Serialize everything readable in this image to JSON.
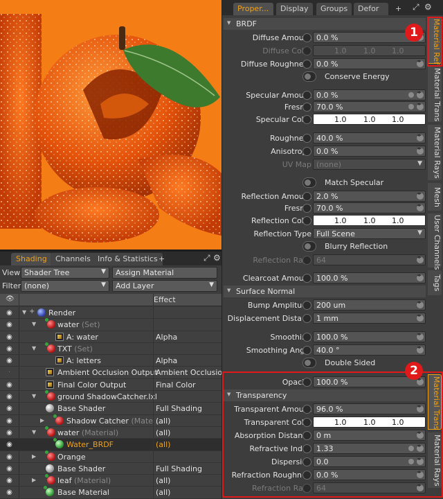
{
  "shading": {
    "tabs": [
      "Shading",
      "Channels",
      "Info & Statistics",
      "+"
    ],
    "view_label": "View",
    "view_value": "Shader Tree",
    "assign_button": "Assign Material",
    "filter_label": "Filter",
    "filter_value": "(none)",
    "add_layer_button": "Add Layer",
    "effect_header": "Effect",
    "rows": [
      {
        "name": "Render",
        "grey": "",
        "effect": ""
      },
      {
        "name": "water",
        "grey": "(Set)",
        "effect": ""
      },
      {
        "name": "A: water",
        "grey": "",
        "effect": "Alpha"
      },
      {
        "name": "TXT",
        "grey": "(Set)",
        "effect": ""
      },
      {
        "name": "A: letters",
        "grey": "",
        "effect": "Alpha"
      },
      {
        "name": "Ambient Occlusion Output",
        "grey": "",
        "effect": "Ambient Occlusion"
      },
      {
        "name": "Final Color Output",
        "grey": "",
        "effect": "Final Color"
      },
      {
        "name": "ground ShadowCatcher.lxl",
        "grey": "",
        "effect": ""
      },
      {
        "name": "Base Shader",
        "grey": "",
        "effect": "Full Shading"
      },
      {
        "name": "Shadow Catcher",
        "grey": "(Mate ...",
        "effect": "(all)"
      },
      {
        "name": "water",
        "grey": "(Material)",
        "effect": "(all)"
      },
      {
        "name": "Water_BRDF",
        "grey": "",
        "effect": "(all)"
      },
      {
        "name": "Orange",
        "grey": "",
        "effect": ""
      },
      {
        "name": "Base Shader",
        "grey": "",
        "effect": "Full Shading"
      },
      {
        "name": "leaf",
        "grey": "(Material)",
        "effect": "(all)"
      },
      {
        "name": "Base Material",
        "grey": "",
        "effect": "(all)"
      }
    ]
  },
  "props": {
    "tabs": [
      "Proper...",
      "Display",
      "Groups",
      "Defor",
      "+"
    ],
    "side_tabs_top": [
      "Material Ref",
      "Material Trans",
      "Material Rays",
      "Mesh",
      "User Channels",
      "Tags"
    ],
    "side_tabs_bottom": [
      "Material Trans",
      "Material Rays"
    ],
    "sections": {
      "brdf": "BRDF",
      "surface_normal": "Surface Normal",
      "transparency": "Transparency"
    },
    "fields": {
      "diffuse_amount": {
        "label": "Diffuse Amount",
        "value": "0.0 %"
      },
      "diffuse_color": {
        "label": "Diffuse Color",
        "r": "1.0",
        "g": "1.0",
        "b": "1.0"
      },
      "diffuse_roughness": {
        "label": "Diffuse Roughness",
        "value": "0.0 %"
      },
      "conserve_energy": "Conserve Energy",
      "specular_amount": {
        "label": "Specular Amount",
        "value": "0.0 %"
      },
      "fresnel": {
        "label": "Fresnel",
        "value": "70.0 %"
      },
      "specular_color": {
        "label": "Specular Color",
        "r": "1.0",
        "g": "1.0",
        "b": "1.0"
      },
      "roughness": {
        "label": "Roughness",
        "value": "40.0 %"
      },
      "anisotropy": {
        "label": "Anisotropy",
        "value": "0.0 %"
      },
      "uv_map": {
        "label": "UV Map",
        "value": "(none)"
      },
      "match_specular": "Match Specular",
      "reflection_amount": {
        "label": "Reflection Amount",
        "value": "2.0 %"
      },
      "fresnel2": {
        "label": "Fresnel",
        "value": "70.0 %"
      },
      "reflection_color": {
        "label": "Reflection Color",
        "r": "1.0",
        "g": "1.0",
        "b": "1.0"
      },
      "reflection_type": {
        "label": "Reflection Type",
        "value": "Full Scene"
      },
      "blurry_reflection": "Blurry Reflection",
      "reflection_rays": {
        "label": "Reflection Rays",
        "value": "64"
      },
      "clearcoat_amount": {
        "label": "Clearcoat Amount",
        "value": "100.0 %"
      },
      "bump_amplitude": {
        "label": "Bump Amplitude",
        "value": "200 um"
      },
      "displacement_distance": {
        "label": "Displacement Dista ...",
        "value": "1 mm"
      },
      "smoothing": {
        "label": "Smoothing",
        "value": "100.0 %"
      },
      "smoothing_angle": {
        "label": "Smoothing Angle",
        "value": "40.0 °"
      },
      "double_sided": "Double Sided",
      "opacity": {
        "label": "Opacity",
        "value": "100.0 %"
      },
      "transparent_amount": {
        "label": "Transparent Amount",
        "value": "96.0 %"
      },
      "transparent_color": {
        "label": "Transparent Color",
        "r": "1.0",
        "g": "1.0",
        "b": "1.0"
      },
      "absorption_distance": {
        "label": "Absorption Distance",
        "value": "0 m"
      },
      "refractive_index": {
        "label": "Refractive Index",
        "value": "1.33"
      },
      "dispersion": {
        "label": "Dispersion",
        "value": "0.0"
      },
      "refraction_roughness": {
        "label": "Refraction Roughn ...",
        "value": "0.0 %"
      },
      "refraction_rays": {
        "label": "Refraction Rays",
        "value": "64"
      }
    },
    "badges": [
      "1",
      "2"
    ]
  },
  "colors": {
    "accent": "#f0a21b",
    "highlight_box": "#e01a1a",
    "viewport_bg": "#f47d16"
  }
}
